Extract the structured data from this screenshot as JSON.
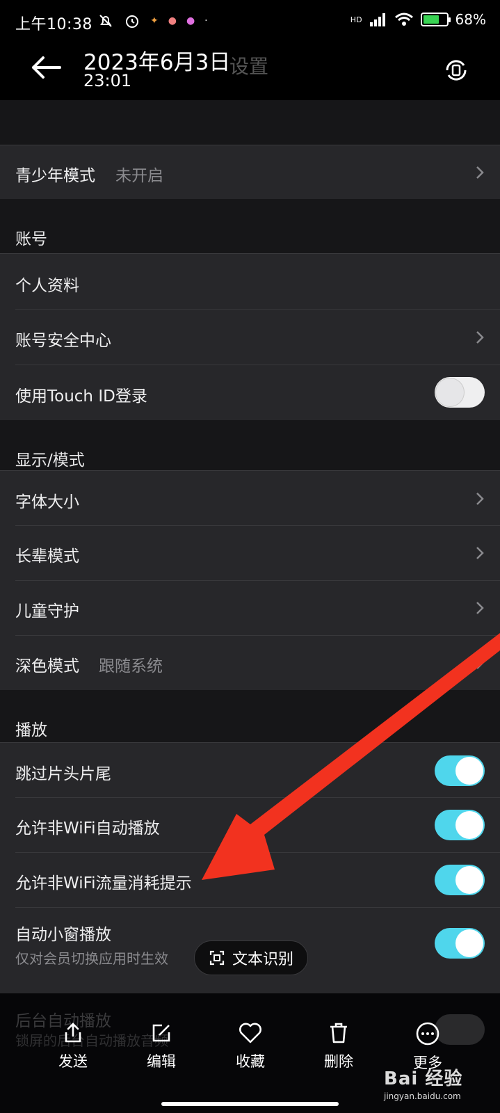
{
  "status_bar": {
    "time": "上午10:38",
    "network": "HD",
    "battery_level": "68%"
  },
  "header": {
    "date": "2023年6月3日",
    "time": "23:01",
    "title": "设置"
  },
  "rows": {
    "youth_mode": {
      "label": "青少年模式",
      "value": "未开启"
    },
    "section_account": "账号",
    "profile": {
      "label": "个人资料"
    },
    "account_security": {
      "label": "账号安全中心"
    },
    "touch_id": {
      "label": "使用Touch ID登录",
      "enabled": false
    },
    "section_display": "显示/模式",
    "font_size": {
      "label": "字体大小"
    },
    "elder_mode": {
      "label": "长辈模式"
    },
    "child_guard": {
      "label": "儿童守护"
    },
    "dark_mode": {
      "label": "深色模式",
      "value": "跟随系统"
    },
    "section_playback": "播放",
    "skip_intro": {
      "label": "跳过片头片尾",
      "enabled": true
    },
    "auto_play_nonwifi": {
      "label": "允许非WiFi自动播放",
      "enabled": true
    },
    "data_usage_hint": {
      "label": "允许非WiFi流量消耗提示",
      "enabled": true
    },
    "pip_play": {
      "label": "自动小窗播放",
      "sub": "仅对会员切换应用时生效",
      "enabled": true
    }
  },
  "ocr_button": {
    "label": "文本识别"
  },
  "bottom_bar": {
    "ghost_label": "后台自动播放",
    "ghost_sub": "锁屏的后台自动播放音频",
    "items": [
      {
        "label": "发送",
        "icon": "share-icon"
      },
      {
        "label": "编辑",
        "icon": "edit-icon"
      },
      {
        "label": "收藏",
        "icon": "heart-icon"
      },
      {
        "label": "删除",
        "icon": "trash-icon"
      },
      {
        "label": "更多",
        "icon": "more-icon"
      }
    ]
  },
  "watermark": {
    "main": "Bai 经验",
    "url": "jingyan.baidu.com"
  },
  "colors": {
    "toggle_on": "#4fd6ec",
    "annotation_arrow": "#f2321f",
    "row_bg": "#27272a"
  }
}
